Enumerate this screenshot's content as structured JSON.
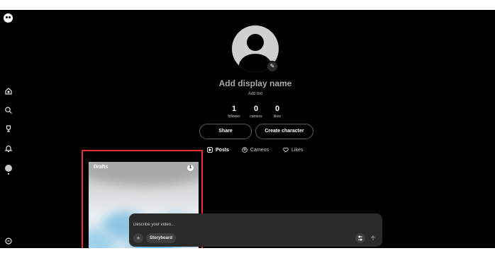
{
  "profile": {
    "display_name": "Add display name",
    "bio": "Add bio",
    "stats": [
      {
        "value": "1",
        "label": "follower"
      },
      {
        "value": "0",
        "label": "cameos"
      },
      {
        "value": "0",
        "label": "likes"
      }
    ],
    "buttons": {
      "share": "Share",
      "create_character": "Create character"
    },
    "tabs": [
      "Posts",
      "Cameos",
      "Likes"
    ]
  },
  "drafts": {
    "title": "Drafts",
    "count": "1"
  },
  "composer": {
    "placeholder": "Describe your video...",
    "add": "+",
    "storyboard": "Storyboard"
  },
  "sidebar": {
    "icons": [
      "app-logo-icon",
      "home-icon",
      "search-icon",
      "trophy-icon",
      "notifications-icon",
      "profile-avatar-icon",
      "settings-icon"
    ]
  },
  "colors": {
    "background": "#000000",
    "highlight": "#e9302f",
    "composer": "#2b2b2b"
  }
}
